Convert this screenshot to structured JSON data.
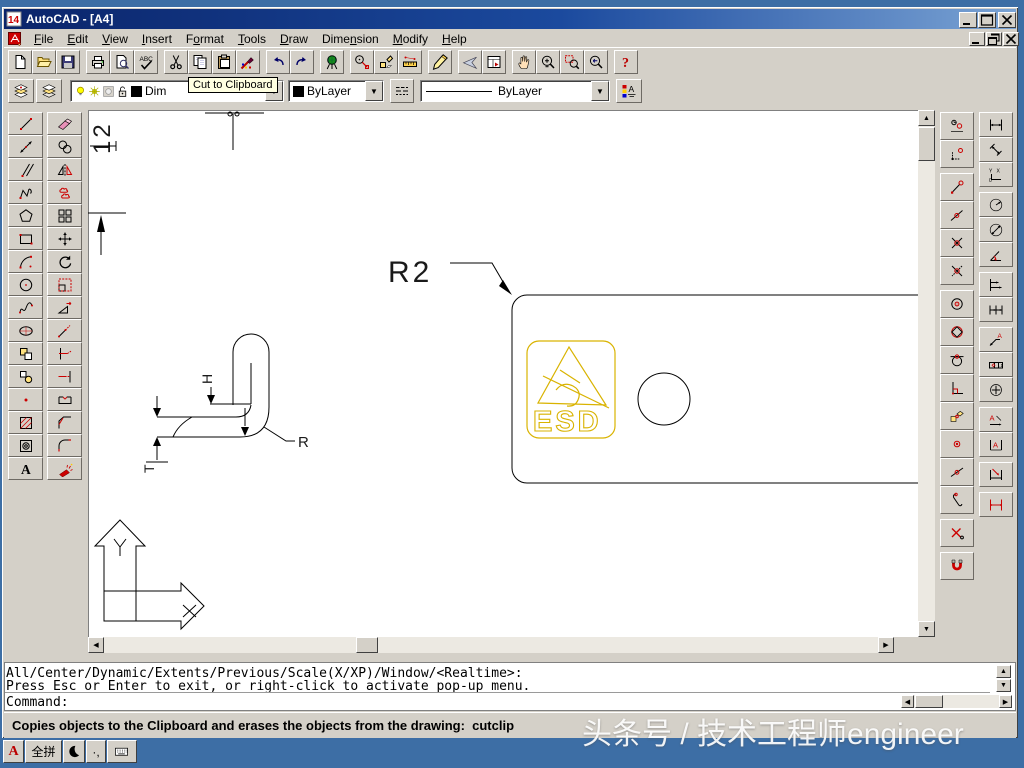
{
  "window": {
    "title": "AutoCAD - [A4]",
    "app_icon": "14"
  },
  "menu": {
    "items": [
      {
        "label": "File",
        "u": 0
      },
      {
        "label": "Edit",
        "u": 0
      },
      {
        "label": "View",
        "u": 0
      },
      {
        "label": "Insert",
        "u": 0
      },
      {
        "label": "Format",
        "u": 1
      },
      {
        "label": "Tools",
        "u": 0
      },
      {
        "label": "Draw",
        "u": 0
      },
      {
        "label": "Dimension",
        "u": 4
      },
      {
        "label": "Modify",
        "u": 0
      },
      {
        "label": "Help",
        "u": 0
      }
    ]
  },
  "standard_toolbar": {
    "groups": [
      [
        "new-file",
        "open-file",
        "save-file"
      ],
      [
        "print",
        "print-preview",
        "spelling"
      ],
      [
        "cut",
        "copy",
        "paste",
        "match-properties"
      ],
      [
        "undo",
        "redo"
      ],
      [
        "launch-browser"
      ],
      [
        "object-snap",
        "ucs",
        "distance"
      ],
      [
        "redraw"
      ],
      [
        "aerial-view",
        "named-views"
      ],
      [
        "pan-realtime",
        "zoom-realtime",
        "zoom-window",
        "zoom-previous"
      ],
      [
        "help"
      ]
    ]
  },
  "tooltip": {
    "text": "Cut to Clipboard"
  },
  "properties_toolbar": {
    "layer_combo": {
      "value": "Dim"
    },
    "color_combo": {
      "value": "ByLayer"
    },
    "linetype_combo": {
      "value": "ByLayer"
    }
  },
  "draw_toolbar": {
    "items": [
      "line",
      "construction-line",
      "multiline",
      "polyline",
      "polygon",
      "rectangle",
      "arc",
      "circle",
      "spline",
      "ellipse",
      "insert-block",
      "make-block",
      "point",
      "hatch",
      "region",
      "multiline-text"
    ]
  },
  "modify_toolbar": {
    "items": [
      "erase",
      "copy-object",
      "mirror",
      "offset",
      "array",
      "move",
      "rotate",
      "scale",
      "stretch",
      "lengthen",
      "trim",
      "extend",
      "break",
      "chamfer",
      "fillet",
      "explode"
    ]
  },
  "osnap_toolbar": {
    "groups": [
      [
        "tracking",
        "snap-from"
      ],
      [
        "snap-to-endpoint",
        "snap-to-midpoint",
        "snap-to-intersection",
        "snap-to-apparent-intersection"
      ],
      [
        "snap-to-center",
        "snap-to-quadrant",
        "snap-to-tangent",
        "snap-to-perpendicular",
        "snap-to-insert",
        "snap-to-node",
        "snap-to-nearest",
        "snap-to-quick"
      ],
      [
        "snap-to-none"
      ],
      [
        "osnap-settings"
      ]
    ]
  },
  "dimension_toolbar": {
    "groups": [
      [
        "linear-dimension",
        "aligned-dimension",
        "ordinate-dimension"
      ],
      [
        "radius-dimension",
        "diameter-dimension",
        "angular-dimension"
      ],
      [
        "baseline-dimension",
        "continue-dimension"
      ],
      [
        "leader",
        "tolerance",
        "center-mark"
      ],
      [
        "dimension-edit",
        "dimension-text-edit"
      ],
      [
        "dimension-update"
      ],
      [
        "dimension-style"
      ]
    ]
  },
  "canvas": {
    "labels": {
      "dim12": "12",
      "r2": "R2",
      "h": "H",
      "r": "R",
      "t": "T",
      "esd": "ESD",
      "ucs_x": "X",
      "ucs_y": "Y"
    },
    "colors": {
      "line": "#000000",
      "esd_logo": "#d9b300"
    }
  },
  "command_window": {
    "lines": [
      "All/Center/Dynamic/Extents/Previous/Scale(X/XP)/Window/<Realtime>:",
      "Press Esc or Enter to exit, or right-click to activate pop-up menu.",
      "Command:"
    ]
  },
  "status_bar": {
    "text": "Copies objects to the Clipboard and erases the objects from the drawing:  cutclip"
  },
  "ime_bar": {
    "language": "A",
    "mode": "全拼",
    "punctuation": "·,"
  },
  "watermark": {
    "text": "头条号 / 技术工程师engineer"
  }
}
